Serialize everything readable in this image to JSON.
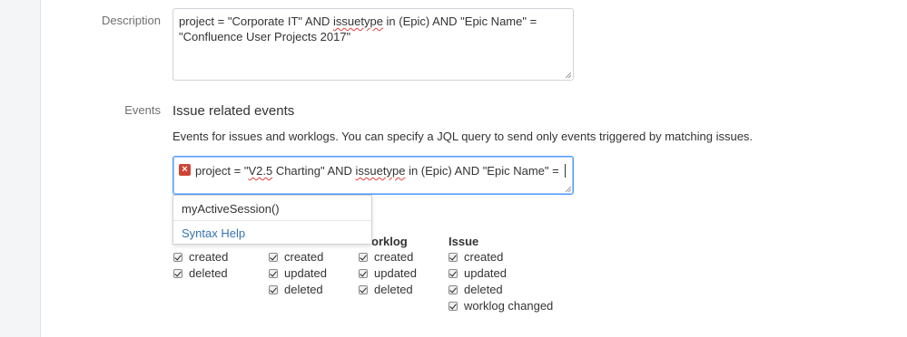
{
  "description": {
    "label": "Description",
    "value_line1_a": "project = \"Corporate IT\" AND ",
    "value_line1_b": "issuetype",
    "value_line1_c": " in (Epic) AND \"Epic Name\" =",
    "value_line2": "\"Confluence User Projects 2017\""
  },
  "events": {
    "label": "Events",
    "section_title": "Issue related events",
    "help_text": "Events for issues and worklogs. You can specify a JQL query to send only events triggered by matching issues.",
    "jql": {
      "part1": "project = \"",
      "part2": "V2.5",
      "part3": " Charting\"  AND ",
      "part4": "issuetype",
      "part5": " in (Epic) AND \"Epic Name\" = "
    },
    "error_glyph": "×",
    "autocomplete": {
      "item": "myActiveSession()",
      "syntax_help": "Syntax Help"
    },
    "columns": {
      "col1": {
        "items": [
          "created",
          "deleted"
        ]
      },
      "col2": {
        "items": [
          "created",
          "updated",
          "deleted"
        ]
      },
      "col3": {
        "header": "orklog",
        "items": [
          "created",
          "updated",
          "deleted"
        ]
      },
      "col4": {
        "header": "Issue",
        "items": [
          "created",
          "updated",
          "deleted",
          "worklog changed"
        ]
      }
    }
  },
  "colors": {
    "link": "#3572b0",
    "focus_border": "#4c9aff",
    "error": "#d04437"
  }
}
